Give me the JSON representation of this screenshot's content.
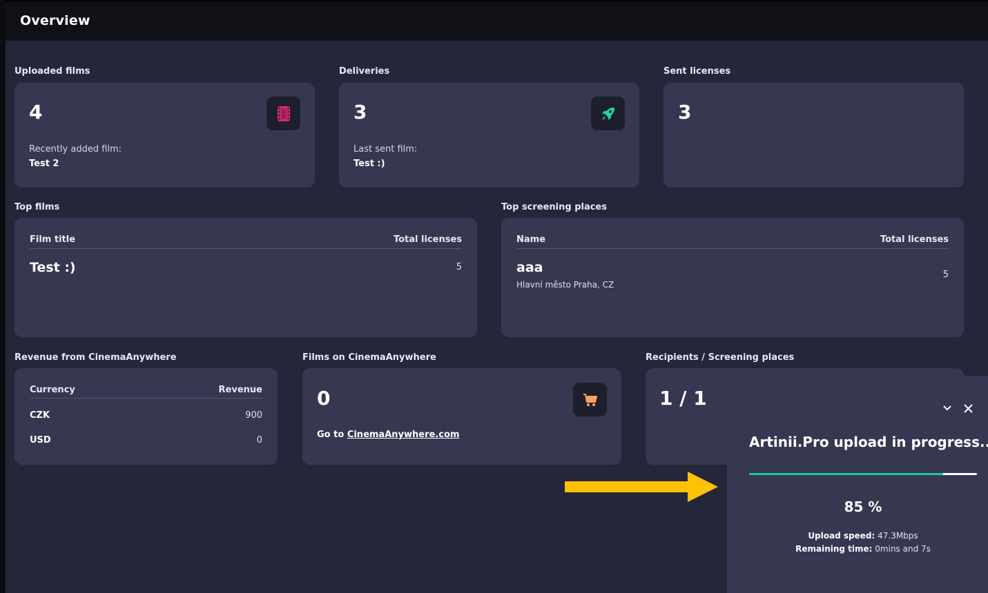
{
  "header": {
    "title": "Overview"
  },
  "uploaded_films": {
    "label": "Uploaded films",
    "count": "4",
    "recent_label": "Recently added film:",
    "recent_value": "Test 2",
    "icon": "film-icon",
    "icon_color": "#e0247a"
  },
  "deliveries": {
    "label": "Deliveries",
    "count": "3",
    "last_label": "Last sent film:",
    "last_value": "Test :)",
    "icon": "rocket-icon",
    "icon_color": "#1fd8a4"
  },
  "sent_licenses": {
    "label": "Sent licenses",
    "count": "3"
  },
  "top_films": {
    "label": "Top films",
    "columns": [
      "Film title",
      "Total licenses"
    ],
    "rows": [
      {
        "title": "Test :)",
        "licenses": "5"
      }
    ]
  },
  "top_places": {
    "label": "Top screening places",
    "columns": [
      "Name",
      "Total licenses"
    ],
    "rows": [
      {
        "name": "aaa",
        "location": "Hlavní město Praha, CZ",
        "licenses": "5"
      }
    ]
  },
  "revenue": {
    "label": "Revenue from CinemaAnywhere",
    "columns": [
      "Currency",
      "Revenue"
    ],
    "rows": [
      {
        "currency": "CZK",
        "value": "900"
      },
      {
        "currency": "USD",
        "value": "0"
      }
    ]
  },
  "films_ca": {
    "label": "Films on CinemaAnywhere",
    "count": "0",
    "link_prefix": "Go to ",
    "link_text": "CinemaAnywhere.com",
    "icon": "cart-icon",
    "icon_color": "#f7a35c"
  },
  "recipients": {
    "label": "Recipients / Screening places",
    "count": "1 / 1"
  },
  "upload": {
    "title": "Artinii.Pro upload in progress...",
    "progress": 85,
    "percent_text": "85 %",
    "speed_label": "Upload speed:",
    "speed_value": "47.3Mbps",
    "remaining_label": "Remaining time:",
    "remaining_value": "0mins and 7s",
    "accent": "#1fc8a0"
  },
  "annotation": {
    "arrow_color": "#ffc107"
  }
}
